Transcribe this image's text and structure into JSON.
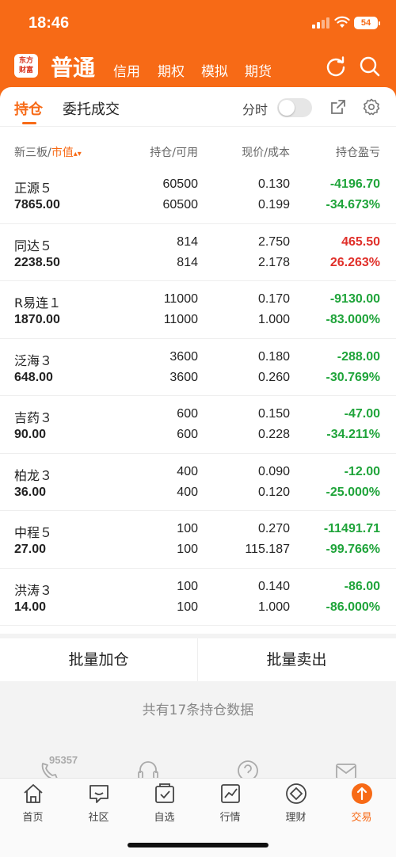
{
  "status": {
    "time": "18:46",
    "battery": "54"
  },
  "nav": {
    "logo": "东方财富",
    "main": "普通",
    "tabs": [
      "信用",
      "期权",
      "模拟",
      "期货"
    ]
  },
  "subtabs": {
    "positions": "持仓",
    "orders": "委托成交",
    "toggle_label": "分时"
  },
  "columns": {
    "name": "新三板/",
    "name_sort": "市值",
    "qty": "持仓/可用",
    "price": "现价/成本",
    "pnl": "持仓盈亏"
  },
  "holdings": [
    {
      "name": "正源５",
      "market_value": "7865.00",
      "qty": "60500",
      "avail": "60500",
      "price": "0.130",
      "cost": "0.199",
      "pnl": "-4196.70",
      "pnl_pct": "-34.673%",
      "dir": "neg"
    },
    {
      "name": "同达５",
      "market_value": "2238.50",
      "qty": "814",
      "avail": "814",
      "price": "2.750",
      "cost": "2.178",
      "pnl": "465.50",
      "pnl_pct": "26.263%",
      "dir": "pos"
    },
    {
      "name": "R易连１",
      "market_value": "1870.00",
      "qty": "11000",
      "avail": "11000",
      "price": "0.170",
      "cost": "1.000",
      "pnl": "-9130.00",
      "pnl_pct": "-83.000%",
      "dir": "neg"
    },
    {
      "name": "泛海３",
      "market_value": "648.00",
      "qty": "3600",
      "avail": "3600",
      "price": "0.180",
      "cost": "0.260",
      "pnl": "-288.00",
      "pnl_pct": "-30.769%",
      "dir": "neg"
    },
    {
      "name": "吉药３",
      "market_value": "90.00",
      "qty": "600",
      "avail": "600",
      "price": "0.150",
      "cost": "0.228",
      "pnl": "-47.00",
      "pnl_pct": "-34.211%",
      "dir": "neg"
    },
    {
      "name": "柏龙３",
      "market_value": "36.00",
      "qty": "400",
      "avail": "400",
      "price": "0.090",
      "cost": "0.120",
      "pnl": "-12.00",
      "pnl_pct": "-25.000%",
      "dir": "neg"
    },
    {
      "name": "中程５",
      "market_value": "27.00",
      "qty": "100",
      "avail": "100",
      "price": "0.270",
      "cost": "115.187",
      "pnl": "-11491.71",
      "pnl_pct": "-99.766%",
      "dir": "neg"
    },
    {
      "name": "洪涛３",
      "market_value": "14.00",
      "qty": "100",
      "avail": "100",
      "price": "0.140",
      "cost": "1.000",
      "pnl": "-86.00",
      "pnl_pct": "-86.000%",
      "dir": "neg"
    }
  ],
  "batch": {
    "add": "批量加仓",
    "sell": "批量卖出"
  },
  "summary": "共有17条持仓数据",
  "service": {
    "phone": "95357"
  },
  "tabbar": [
    {
      "label": "首页",
      "icon": "home-icon"
    },
    {
      "label": "社区",
      "icon": "community-icon"
    },
    {
      "label": "自选",
      "icon": "watchlist-icon"
    },
    {
      "label": "行情",
      "icon": "market-icon"
    },
    {
      "label": "理财",
      "icon": "wealth-icon"
    },
    {
      "label": "交易",
      "icon": "trade-icon"
    }
  ],
  "colors": {
    "accent": "#f76a16",
    "loss": "#1fa43a",
    "gain": "#e0302a"
  }
}
